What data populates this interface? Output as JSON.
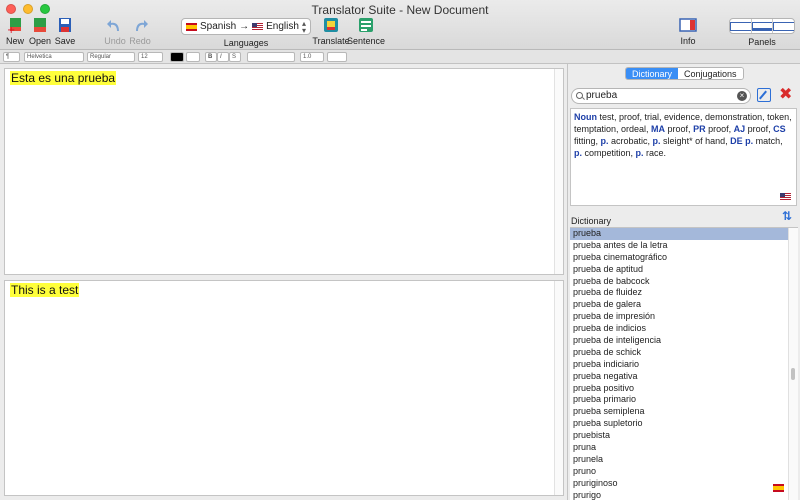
{
  "window": {
    "title": "Translator Suite - New Document"
  },
  "toolbar": {
    "new": "New",
    "open": "Open",
    "save": "Save",
    "undo": "Undo",
    "redo": "Redo",
    "source_lang": "Spanish",
    "target_lang": "English",
    "arrow": "→",
    "languages": "Languages",
    "translate": "Translate",
    "sentence": "Sentence",
    "info": "Info",
    "panels": "Panels"
  },
  "format_bar": {
    "paragraph": "¶",
    "font": "Helvetica",
    "style": "Regular",
    "size": "12",
    "bold": "B",
    "italic": "I",
    "underline": "S",
    "line_spacing": "1.0"
  },
  "editor": {
    "source_text": "Esta es una prueba",
    "translated_text": "This is a test"
  },
  "right_panel": {
    "tab_dictionary": "Dictionary",
    "tab_conjugations": "Conjugations",
    "search_value": "prueba",
    "clear": "×",
    "delete": "✖",
    "swap": "⇅",
    "definition": {
      "pos_noun": "Noun",
      "text1": " test, proof, trial, evidence, demonstration, token, temptation, ordeal, ",
      "ma": "MA",
      "text2": " proof, ",
      "pr": "PR",
      "text3": " proof, ",
      "aj": "AJ",
      "text4": " proof, ",
      "cs": "CS",
      "text5": " fitting, ",
      "p1": "p.",
      "text6": " acrobatic, ",
      "p2": "p.",
      "text7": " sleight* of hand, ",
      "de": "DE",
      "p3": "p.",
      "text8": " match, ",
      "p4": "p.",
      "text9": " competition, ",
      "p5": "p.",
      "text10": " race."
    },
    "dictionary_label": "Dictionary",
    "entries": [
      "prueba",
      "prueba antes de la letra",
      "prueba cinematográfico",
      "prueba de aptitud",
      "prueba de babcock",
      "prueba de fluidez",
      "prueba de galera",
      "prueba de impresión",
      "prueba de indicios",
      "prueba de inteligencia",
      "prueba de schick",
      "prueba indiciario",
      "prueba negativa",
      "prueba positivo",
      "prueba primario",
      "prueba semiplena",
      "prueba supletorio",
      "pruebista",
      "pruna",
      "prunela",
      "pruno",
      "pruriginoso",
      "prurigo"
    ]
  },
  "colors": {
    "accent": "#3a8ef5",
    "highlight": "#ffff3c",
    "selection": "#a4b8da",
    "pos": "#1d3fa8"
  }
}
